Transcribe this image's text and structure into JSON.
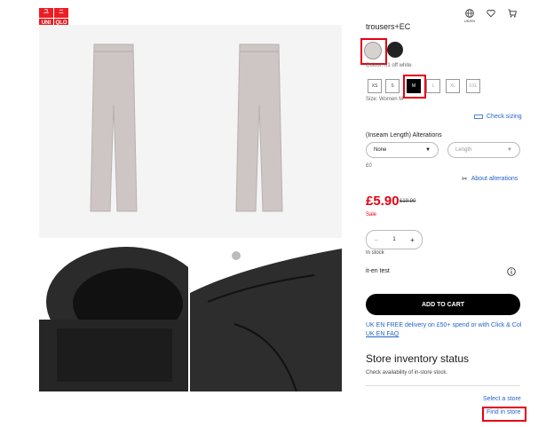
{
  "header": {
    "logo_letters": [
      "ユ",
      "ニ",
      "UNI",
      "QLO"
    ],
    "icons": [
      {
        "name": "globe-icon",
        "caption": "UK/EN"
      },
      {
        "name": "heart-icon",
        "caption": ""
      },
      {
        "name": "cart-icon",
        "caption": ""
      }
    ]
  },
  "product": {
    "title": "trousers+EC",
    "colour_label": "Colour: 01 off white",
    "sizes": [
      "XS",
      "S",
      "M",
      "L",
      "XL",
      "XXL"
    ],
    "selected_size": "M",
    "size_label": "Size: Women M",
    "check_sizing": "Check sizing",
    "alterations_title": "(Inseam Length) Alterations",
    "alteration_select": "None",
    "length_select": "Length",
    "alteration_price": "£0",
    "about_alterations": "About alterations",
    "price": "£5.90",
    "old_price": "£19.90",
    "sale": "Sale",
    "quantity": "1",
    "minus": "−",
    "plus": "+",
    "stock": "In stock",
    "test_label": "it-en test",
    "add_to_cart": "ADD TO CART",
    "delivery_line1": "UK EN FREE delivery on £50+ spend or with Click & Col",
    "delivery_line2": "UK EN FAQ",
    "store_title": "Store inventory status",
    "store_sub": "Check availability of in-store stock.",
    "select_store": "Select a store",
    "find_in_store": "Find in store"
  },
  "colors": {
    "brand": "#ed1d24",
    "link": "#2563c9",
    "sale": "#e60012"
  }
}
